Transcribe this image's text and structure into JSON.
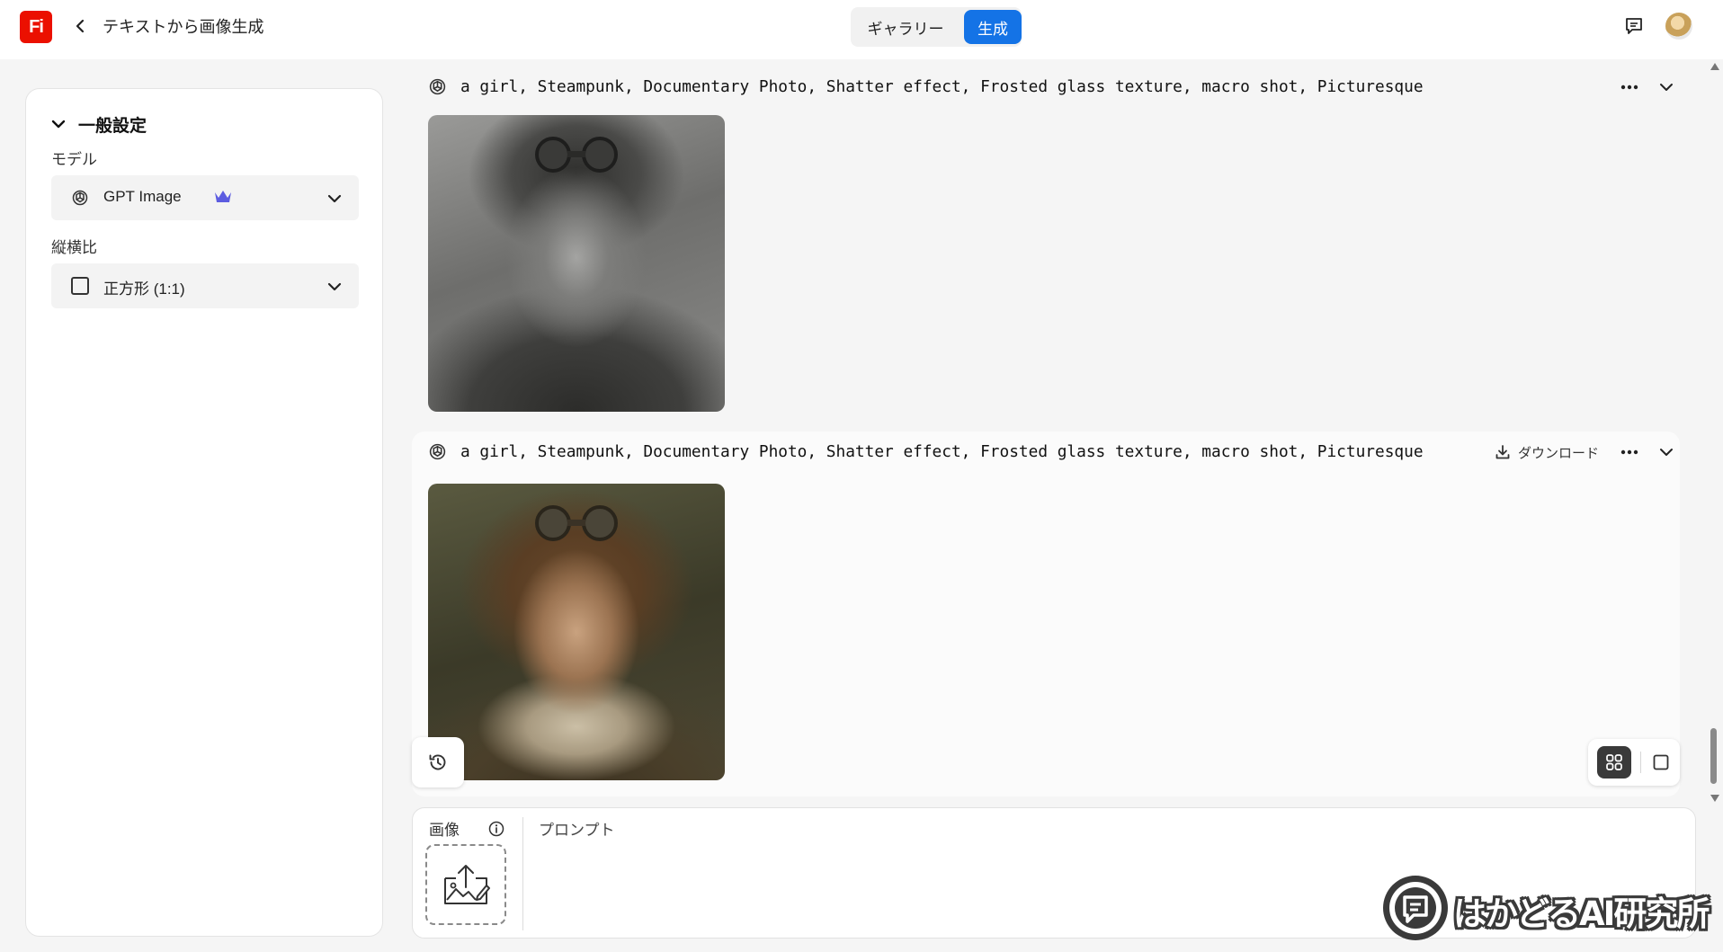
{
  "header": {
    "app_logo": "Fi",
    "page_title": "テキストから画像生成",
    "tabs": [
      {
        "label": "ギャラリー",
        "active": false
      },
      {
        "label": "生成",
        "active": true
      }
    ]
  },
  "settings": {
    "section_title": "一般設定",
    "model_label": "モデル",
    "model_value": "GPT Image",
    "aspect_label": "縦横比",
    "aspect_value": "正方形 (1:1)"
  },
  "results": [
    {
      "prompt": "a girl, Steampunk, Documentary Photo, Shatter effect, Frosted glass texture, macro shot, Picturesque",
      "image_alt": "monochrome steampunk girl portrait with goggles"
    },
    {
      "prompt": "a girl, Steampunk, Documentary Photo, Shatter effect, Frosted glass texture, macro shot, Picturesque",
      "download_label": "ダウンロード",
      "image_alt": "sepia steampunk girl portrait with goggles"
    }
  ],
  "composer": {
    "image_label": "画像",
    "prompt_placeholder": "プロンプト"
  },
  "watermark": {
    "text": "はかどるAI研究所"
  },
  "colors": {
    "brand_red": "#eb1000",
    "accent_blue": "#1473e6",
    "crown_purple": "#5c5ce0"
  }
}
